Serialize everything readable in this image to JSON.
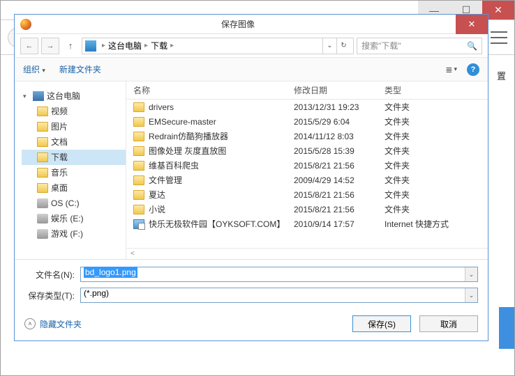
{
  "outer": {
    "hamburger_name": "menu",
    "right_char": "置"
  },
  "dialog": {
    "title": "保存图像",
    "nav": {
      "back": "←",
      "forward": "→",
      "up": "↑",
      "breadcrumb": {
        "root": "这台电脑",
        "path": "下载"
      },
      "refresh": "↻",
      "search_placeholder": "搜索\"下载\""
    },
    "toolbar": {
      "organize": "组织",
      "newfolder": "新建文件夹",
      "view_icon": "≣",
      "help": "?"
    },
    "tree": [
      {
        "label": "这台电脑",
        "icon": "pc",
        "arrow": "▾",
        "indent": false
      },
      {
        "label": "视频",
        "icon": "fld",
        "indent": true
      },
      {
        "label": "图片",
        "icon": "fld",
        "indent": true
      },
      {
        "label": "文档",
        "icon": "fld",
        "indent": true
      },
      {
        "label": "下载",
        "icon": "fld",
        "indent": true,
        "selected": true
      },
      {
        "label": "音乐",
        "icon": "fld",
        "indent": true
      },
      {
        "label": "桌面",
        "icon": "fld",
        "indent": true
      },
      {
        "label": "OS (C:)",
        "icon": "drv",
        "indent": true
      },
      {
        "label": "娱乐 (E:)",
        "icon": "drv",
        "indent": true
      },
      {
        "label": "游戏 (F:)",
        "icon": "drv",
        "indent": true
      }
    ],
    "columns": {
      "name": "名称",
      "date": "修改日期",
      "type": "类型"
    },
    "rows": [
      {
        "name": "drivers",
        "date": "2013/12/31 19:23",
        "type": "文件夹",
        "icon": "fld"
      },
      {
        "name": "EMSecure-master",
        "date": "2015/5/29 6:04",
        "type": "文件夹",
        "icon": "fld"
      },
      {
        "name": "Redrain仿酷狗播放器",
        "date": "2014/11/12 8:03",
        "type": "文件夹",
        "icon": "fld"
      },
      {
        "name": "图像处理 灰度直放图",
        "date": "2015/5/28 15:39",
        "type": "文件夹",
        "icon": "fld"
      },
      {
        "name": "维基百科爬虫",
        "date": "2015/8/21 21:56",
        "type": "文件夹",
        "icon": "fld"
      },
      {
        "name": "文件管理",
        "date": "2009/4/29 14:52",
        "type": "文件夹",
        "icon": "fld"
      },
      {
        "name": "夏达",
        "date": "2015/8/21 21:56",
        "type": "文件夹",
        "icon": "fld"
      },
      {
        "name": "小说",
        "date": "2015/8/21 21:56",
        "type": "文件夹",
        "icon": "fld"
      },
      {
        "name": "快乐无极软件园【OYKSOFT.COM】",
        "date": "2010/9/14 17:57",
        "type": "Internet 快捷方式",
        "icon": "link"
      }
    ],
    "scroll_hint": "<",
    "filename_label": "文件名(N):",
    "filename_value": "bd_logo1.png",
    "filetype_label": "保存类型(T):",
    "filetype_value": "(*.png)",
    "hide_folders": "隐藏文件夹",
    "save_btn": "保存(S)",
    "cancel_btn": "取消"
  }
}
